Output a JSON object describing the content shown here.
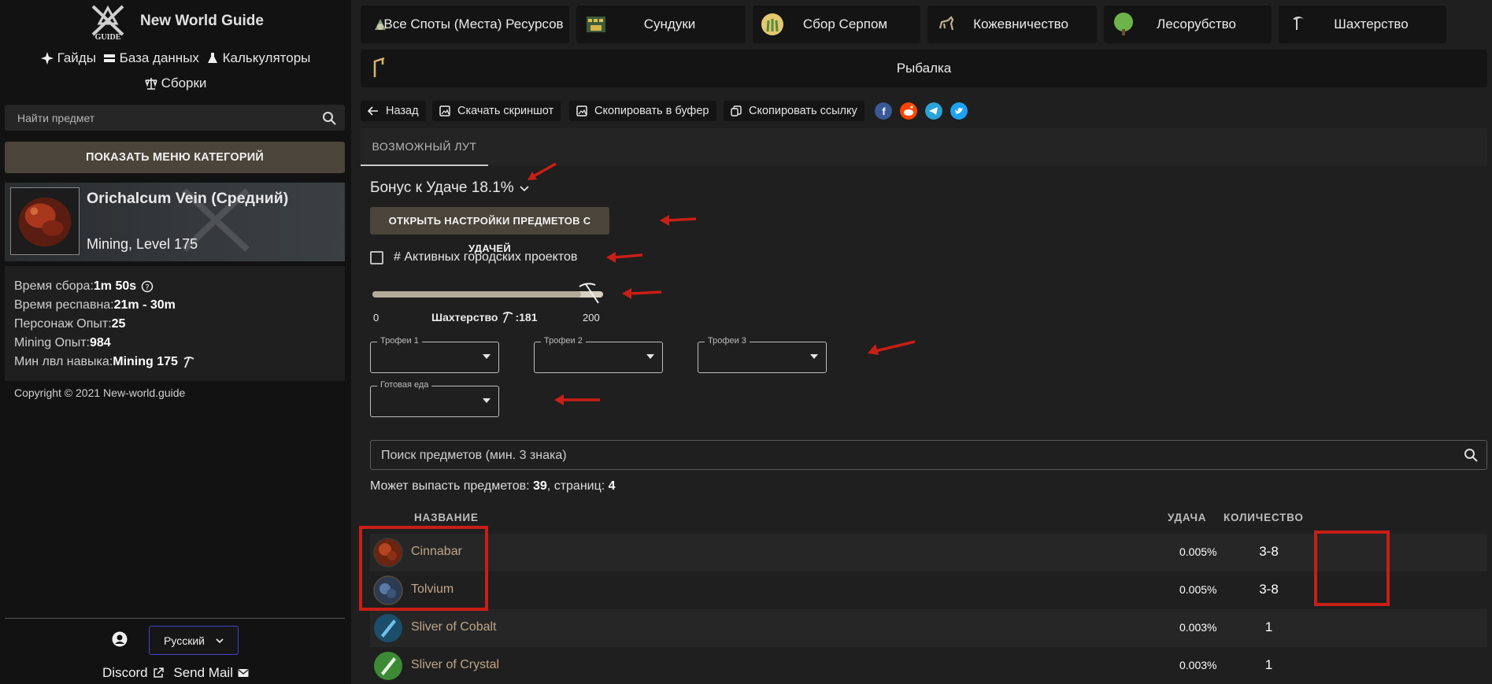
{
  "sidebar": {
    "site_title": "New World Guide",
    "logo_text": "GUIDE",
    "nav": {
      "guides": "Гайды",
      "database": "База данных",
      "calculators": "Калькуляторы",
      "builds": "Сборки"
    },
    "search_placeholder": "Найти предмет",
    "category_button": "ПОКАЗАТЬ МЕНЮ КАТЕГОРИЙ",
    "item": {
      "name": "Orichalcum Vein (Средний)",
      "subtitle": "Mining, Level 175"
    },
    "stats": [
      {
        "label": "Время сбора:",
        "value": "1m 50s"
      },
      {
        "label": "Время респавна: ",
        "value": "21m - 30m"
      },
      {
        "label": "Персонаж Опыт: ",
        "value": "25"
      },
      {
        "label": "Mining Опыт: ",
        "value": "984"
      },
      {
        "label": "Мин лвл навыка: ",
        "value": "Mining 175"
      }
    ],
    "copyright": "Copyright © 2021 New-world.guide",
    "language": "Русский",
    "footer": {
      "discord": "Discord",
      "send_mail": "Send Mail"
    }
  },
  "resource_tabs": [
    {
      "label": "Все Споты (Места) Ресурсов",
      "icon": "resource-spots-icon"
    },
    {
      "label": "Сундуки",
      "icon": "chests-icon"
    },
    {
      "label": "Сбор Серпом",
      "icon": "sickle-icon"
    },
    {
      "label": "Кожевничество",
      "icon": "skinning-icon"
    },
    {
      "label": "Лесорубство",
      "icon": "logging-icon"
    },
    {
      "label": "Шахтерство",
      "icon": "mining-icon"
    }
  ],
  "fishing_tab": {
    "label": "Рыбалка",
    "icon": "fishing-icon"
  },
  "toolbar": {
    "back": "Назад",
    "download_screenshot": "Скачать скриншот",
    "copy_to_buffer": "Скопировать в буфер",
    "copy_link": "Скопировать ссылку"
  },
  "share_colors": {
    "facebook": "#3b5998",
    "reddit": "#ff4500",
    "telegram": "#2aa3d8",
    "twitter": "#1da1f2"
  },
  "tab_loot": "ВОЗМОЖНЫЙ ЛУТ",
  "luck": {
    "title": "Бонус к Удаче 18.1%",
    "open_settings": "ОТКРЫТЬ НАСТРОЙКИ ПРЕДМЕТОВ С УДАЧЕЙ",
    "city_projects": "# Активных городских проектов"
  },
  "slider": {
    "min": "0",
    "max": "200",
    "skill": "Шахтерство",
    "value_text": ":181",
    "value": 181,
    "range": 200
  },
  "selects": {
    "trophy1": "Трофеи 1",
    "trophy2": "Трофеи 2",
    "trophy3": "Трофеи 3",
    "food": "Готовая еда"
  },
  "item_search_placeholder": "Поиск предметов (мин. 3 знака)",
  "drop_info": {
    "prefix": "Может выпасть предметов: ",
    "count": "39",
    "mid": ", страниц: ",
    "pages": "4"
  },
  "table": {
    "headers": {
      "name": "НАЗВАНИЕ",
      "luck": "УДАЧА",
      "qty": "КОЛИЧЕСТВО"
    },
    "rows": [
      {
        "name": "Cinnabar",
        "luck": "0.005%",
        "qty": "3-8",
        "color": "#a23a1c"
      },
      {
        "name": "Tolvium",
        "luck": "0.005%",
        "qty": "3-8",
        "color": "#4a6a95"
      },
      {
        "name": "Sliver of Cobalt",
        "luck": "0.003%",
        "qty": "1",
        "color": "#2f7fb0"
      },
      {
        "name": "Sliver of Crystal",
        "luck": "0.003%",
        "qty": "1",
        "color": "#5cae4c"
      }
    ]
  },
  "colors": {
    "accent_button": "#4a443a",
    "annotation_red": "#c81f16",
    "link_item": "#bfa58a"
  }
}
